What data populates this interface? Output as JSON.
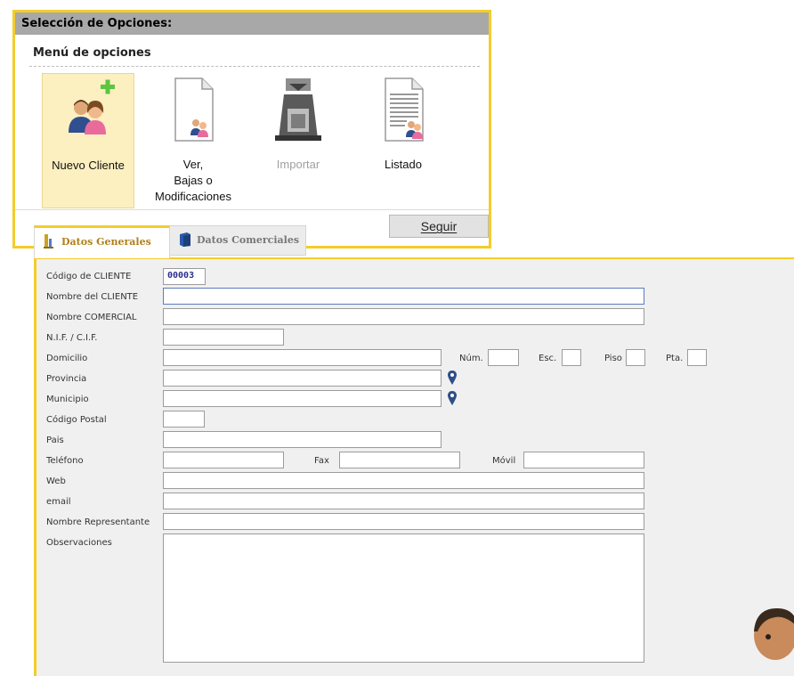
{
  "options_panel": {
    "title": "Selección de Opciones:",
    "subtitle": "Menú de opciones",
    "options": [
      {
        "label": "Nuevo Cliente",
        "icon": "add-customers-icon",
        "selected": true
      },
      {
        "label": "Ver,\nBajas o\nModificaciones",
        "icon": "customer-document-icon"
      },
      {
        "label": "Importar",
        "icon": "import-machine-icon",
        "disabled": true
      },
      {
        "label": "Listado",
        "icon": "customer-list-icon"
      }
    ],
    "continue_label": "Seguir",
    "accent_color": "#f3cd2b",
    "header_color": "#a8a8a8"
  },
  "tabs": [
    {
      "label": "Datos Generales",
      "icon": "ledger-icon",
      "active": true
    },
    {
      "label": "Datos Comerciales",
      "icon": "book-icon",
      "active": false
    }
  ],
  "form": {
    "labels": {
      "code": "Código de CLIENTE",
      "name": "Nombre del CLIENTE",
      "commercial_name": "Nombre COMERCIAL",
      "nif": "N.I.F. / C.I.F.",
      "address": "Domicilio",
      "number": "Núm.",
      "stair": "Esc.",
      "floor": "Piso",
      "door": "Pta.",
      "province": "Provincia",
      "municipality": "Municipio",
      "postal_code": "Código Postal",
      "country": "Pais",
      "phone": "Teléfono",
      "fax": "Fax",
      "mobile": "Móvil",
      "web": "Web",
      "email": "email",
      "representative": "Nombre Representante",
      "notes": "Observaciones"
    },
    "values": {
      "code": "00003",
      "name": "",
      "commercial_name": "",
      "nif": "",
      "address": "",
      "number": "",
      "stair": "",
      "floor": "",
      "door": "",
      "province": "",
      "municipality": "",
      "postal_code": "",
      "country": "",
      "phone": "",
      "fax": "",
      "mobile": "",
      "web": "",
      "email": "",
      "representative": "",
      "notes": ""
    }
  }
}
